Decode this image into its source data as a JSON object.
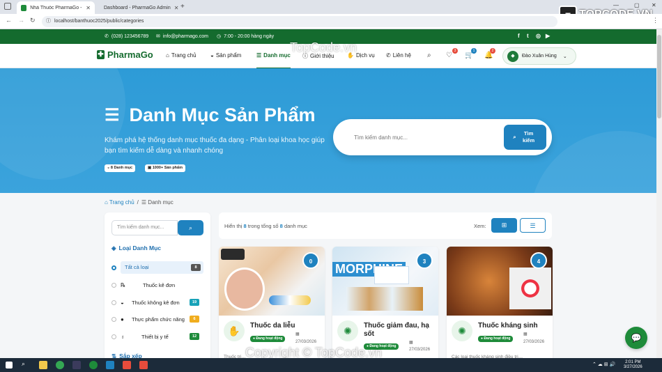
{
  "browser": {
    "tabs": [
      {
        "title": "Nhà Thuốc PharmaGo - Danh M",
        "active": true
      },
      {
        "title": "Dashboard - PharmaGo Admin",
        "active": false
      }
    ],
    "url": "localhost/banthuoc2025/public/categories"
  },
  "topbar": {
    "phone": "(028) 123456789",
    "email": "info@pharmago.com",
    "hours": "7:00 - 20:00 hàng ngày",
    "social": [
      "f",
      "t",
      "ig",
      "yt"
    ]
  },
  "header": {
    "logo": "PharmaGo",
    "nav": [
      {
        "label": "Trang chủ",
        "icon": "home-icon",
        "active": false
      },
      {
        "label": "Sản phẩm",
        "icon": "pills-icon",
        "active": false
      },
      {
        "label": "Danh mục",
        "icon": "list-icon",
        "active": true
      },
      {
        "label": "Giới thiệu",
        "icon": "info-icon",
        "active": false
      },
      {
        "label": "Dịch vụ",
        "icon": "hands-icon",
        "active": false
      },
      {
        "label": "Liên hệ",
        "icon": "phone-icon",
        "active": false
      }
    ],
    "badges": {
      "wishlist": "3",
      "cart": "1",
      "notifications": "2"
    },
    "user_name": "Đào Xuân Hùng"
  },
  "hero": {
    "title": "Danh Mục Sản Phẩm",
    "description": "Khám phá hệ thống danh mục thuốc đa dạng - Phân loại khoa học giúp bạn tìm kiếm dễ dàng và nhanh chóng",
    "stats": [
      "8 Danh mục",
      "1000+ Sản phẩm"
    ],
    "search_placeholder": "Tìm kiếm danh mục...",
    "search_button": "Tìm kiếm"
  },
  "breadcrumb": {
    "home": "Trang chủ",
    "current": "Danh mục"
  },
  "sidebar": {
    "search_placeholder": "Tìm kiếm danh mục...",
    "categories_title": "Loại Danh Mục",
    "categories": [
      {
        "label": "Tất cả loại",
        "count": "8",
        "color": "#555555",
        "icon": "",
        "active": true
      },
      {
        "label": "Thuốc kê đơn",
        "count": "",
        "color": "",
        "icon": "℞",
        "active": false
      },
      {
        "label": "Thuốc không kê đơn",
        "count": "19",
        "color": "#17a2b8",
        "icon": "✚",
        "active": false
      },
      {
        "label": "Thực phẩm chức năng",
        "count": "6",
        "color": "#f0ad1e",
        "icon": "●",
        "active": false
      },
      {
        "label": "Thiết bị y tế",
        "count": "12",
        "color": "#1e8b3a",
        "icon": "♥",
        "active": false
      }
    ],
    "sort_title": "Sắp xếp"
  },
  "results": {
    "prefix": "Hiển thị",
    "shown": "8",
    "middle": "trong tổng số",
    "total": "8",
    "suffix": "danh mục",
    "view_label": "Xem:"
  },
  "cards": [
    {
      "title": "Thuốc da liễu",
      "count": "0",
      "status": "Đang hoạt động",
      "date": "27/03/2026",
      "desc": "Thuốc trị…",
      "icon": "hand-icon"
    },
    {
      "title": "Thuốc giảm đau, hạ sốt",
      "count": "3",
      "status": "Đang hoạt động",
      "date": "27/03/2026",
      "desc": "",
      "icon": "virus-icon",
      "img_label": "MORPHINE"
    },
    {
      "title": "Thuốc kháng sinh",
      "count": "4",
      "status": "Đang hoạt động",
      "date": "27/03/2026",
      "desc": "Các loại thuốc kháng sinh điều trị…",
      "icon": "bacteria-icon"
    }
  ],
  "watermarks": [
    "TopCode.vn",
    "Copyright © TopCode.vn"
  ],
  "brand": "TOPCODE.VN",
  "clock": {
    "time": "2:01 PM",
    "date": "3/27/2026"
  }
}
